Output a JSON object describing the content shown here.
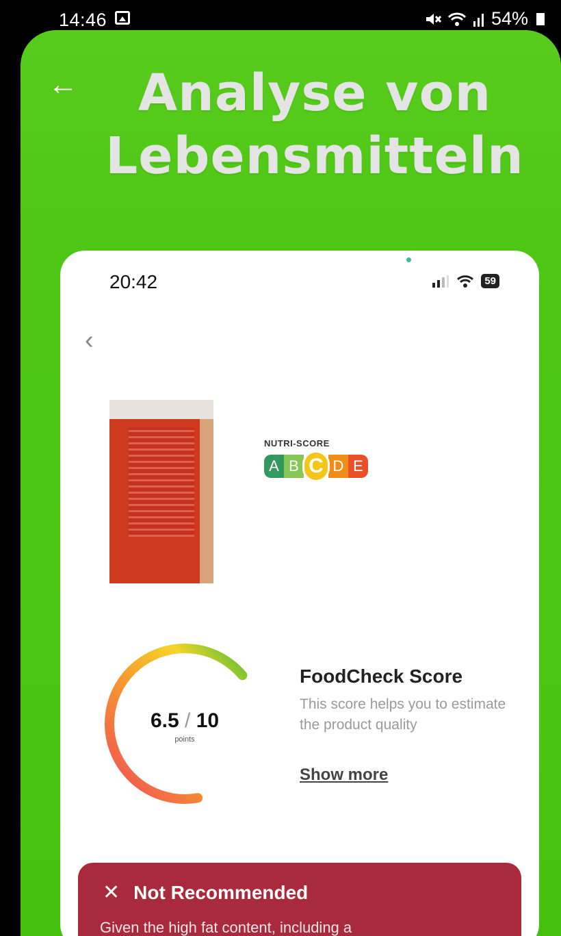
{
  "status_bar": {
    "time": "14:46",
    "battery": "54%"
  },
  "header": {
    "title_line1": "Analyse von",
    "title_line2": "Lebensmitteln"
  },
  "screenshot": {
    "status": {
      "time": "20:42",
      "battery": "59"
    },
    "nutri_score": {
      "title": "NUTRI-SCORE",
      "grades": [
        {
          "letter": "A",
          "color": "#1e8f4e"
        },
        {
          "letter": "B",
          "color": "#7ac143"
        },
        {
          "letter": "C",
          "color": "#f5c518"
        },
        {
          "letter": "D",
          "color": "#ee8100"
        },
        {
          "letter": "E",
          "color": "#e63e11"
        }
      ],
      "selected": "C"
    },
    "foodcheck": {
      "score": "6.5",
      "separator": "/",
      "max": "10",
      "unit": "points",
      "title": "FoodCheck Score",
      "description": "This score helps you to estimate the product quality",
      "show_more": "Show more",
      "level": 0.65
    },
    "alert": {
      "title": "Not Recommended",
      "body": "Given the high fat content, including a"
    }
  },
  "colors": {
    "background": "#4cc515",
    "alert": "#a82a3c"
  }
}
